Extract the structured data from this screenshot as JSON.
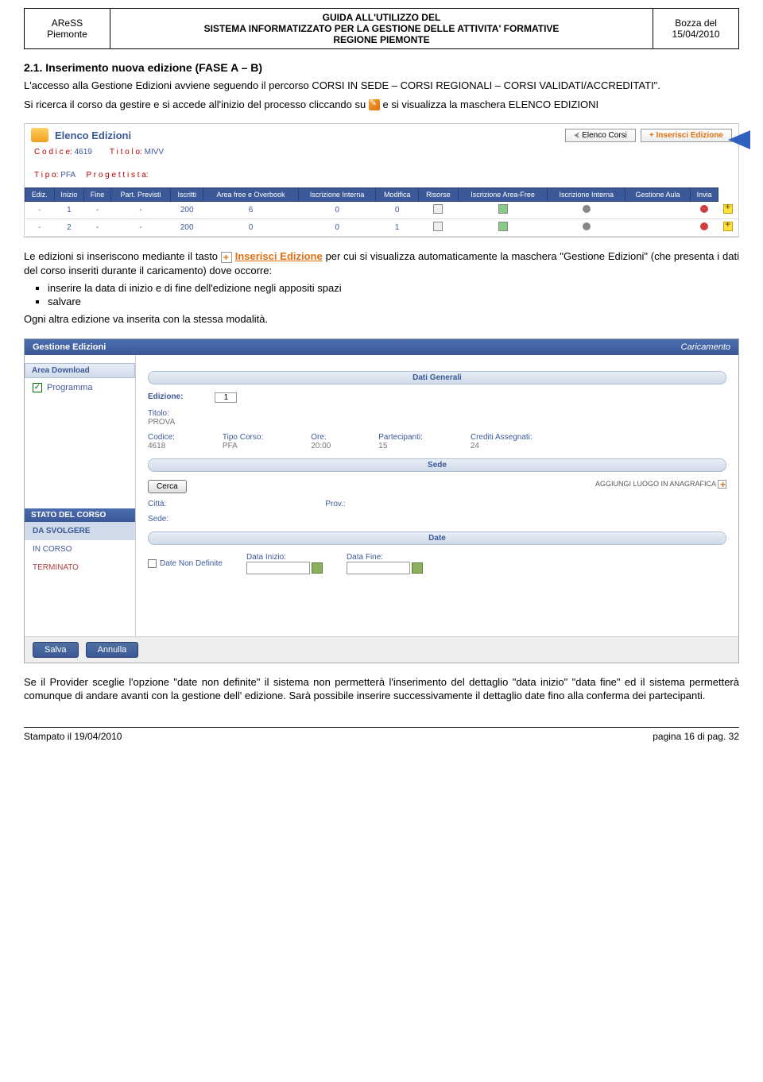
{
  "header": {
    "left1": "AReSS",
    "left2": "Piemonte",
    "mid1": "GUIDA ALL'UTILIZZO DEL",
    "mid2": "SISTEMA INFORMATIZZATO  PER LA GESTIONE DELLE ATTIVITA' FORMATIVE",
    "mid3": "REGIONE PIEMONTE",
    "right1": "Bozza del",
    "right2": "15/04/2010"
  },
  "section": {
    "num_title": "2.1.    Inserimento nuova edizione (FASE A – B)",
    "p1a": "L'accesso alla Gestione Edizioni avviene seguendo il percorso CORSI IN SEDE – CORSI REGIONALI – CORSI VALIDATI/ACCREDITATI\".",
    "p1b_a": "Si ricerca il corso da gestire e si accede all'inizio del processo cliccando su ",
    "p1b_b": " e si visualizza la maschera ELENCO EDIZIONI",
    "p2a": "Le edizioni si inseriscono mediante il tasto ",
    "p2b": "Inserisci Edizione",
    "p2c": " per cui si visualizza automaticamente la maschera \"Gestione Edizioni\" (che presenta i dati del corso inseriti durante il caricamento) dove occorre:",
    "li1": "inserire la data di inizio e di fine dell'edizione negli appositi spazi",
    "li2": "salvare",
    "p3": "Ogni altra edizione va inserita con la stessa modalità.",
    "p4": "Se il Provider sceglie l'opzione \"date non definite\" il sistema non permetterà l'inserimento del dettaglio  \"data inizio\" \"data fine\" ed il sistema permetterà comunque di andare avanti con la gestione dell' edizione. Sarà possibile inserire successivamente il dettaglio date fino alla conferma dei partecipanti."
  },
  "sshot1": {
    "title": "Elenco Edizioni",
    "btn_back": "Elenco Corsi",
    "btn_ins": "Inserisci Edizione",
    "codice_lbl": "C o d i c e:",
    "codice_val": "4619",
    "titolo_lbl": "T i t o l o:",
    "titolo_val": "MIVV",
    "tipo_lbl": "T i p o:",
    "tipo_val": "PFA",
    "prog_lbl": "P r o g e t t i s t a:",
    "cols": [
      "Ediz.",
      "Inizio",
      "Fine",
      "Part. Previsti",
      "Iscritti",
      "Area free e Overbook",
      "Iscrizione Interna",
      "Modifica",
      "Risorse",
      "Iscrizione Area-Free",
      "Iscrizione Interna",
      "Gestione Aula",
      "Invia"
    ],
    "rows": [
      {
        "ediz": "1",
        "inizio": "-",
        "fine": "-",
        "part": "200",
        "iscr": "6",
        "area": "0",
        "iscint": "0"
      },
      {
        "ediz": "2",
        "inizio": "-",
        "fine": "-",
        "part": "200",
        "iscr": "0",
        "area": "0",
        "iscint": "1"
      }
    ]
  },
  "sshot2": {
    "head": "Gestione Edizioni",
    "head_right": "Caricamento",
    "area_dl": "Area Download",
    "programma": "Programma",
    "stato_head": "STATO DEL CORSO",
    "stato1": "DA SVOLGERE",
    "stato2": "IN CORSO",
    "stato3": "TERMINATO",
    "dati_gen": "Dati Generali",
    "edizione_lbl": "Edizione:",
    "edizione_val": "1",
    "titolo_lbl": "Titolo:",
    "titolo_val": "PROVA",
    "codice_lbl": "Codice:",
    "codice_val": "4618",
    "tipoc_lbl": "Tipo Corso:",
    "tipoc_val": "PFA",
    "ore_lbl": "Ore:",
    "ore_val": "20:00",
    "part_lbl": "Partecipanti:",
    "part_val": "15",
    "cred_lbl": "Crediti Assegnati:",
    "cred_val": "24",
    "sede": "Sede",
    "cerca": "Cerca",
    "aggiungi": "AGGIUNGI LUOGO IN ANAGRAFICA",
    "citta": "Città:",
    "prov": "Prov.:",
    "sede_lbl": "Sede:",
    "date": "Date",
    "date_nd": "Date Non Definite",
    "data_inizio": "Data Inizio:",
    "data_fine": "Data Fine:",
    "salva": "Salva",
    "annulla": "Annulla"
  },
  "footer": {
    "left": "Stampato il 19/04/2010",
    "right": "pagina 16 di pag. 32"
  }
}
